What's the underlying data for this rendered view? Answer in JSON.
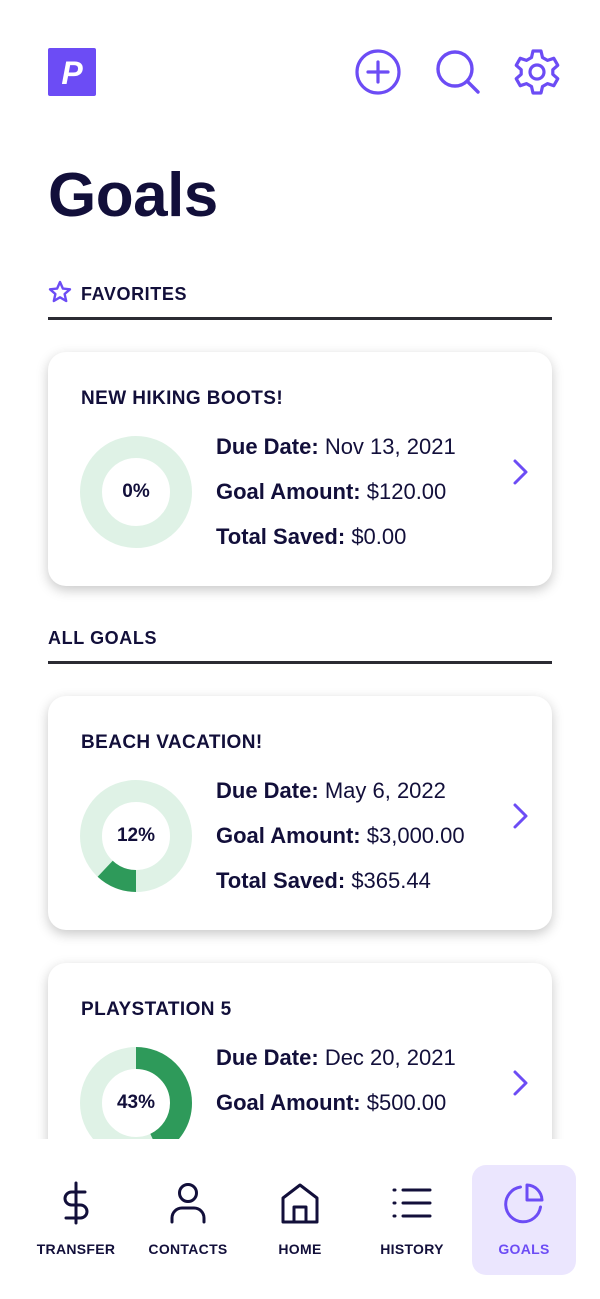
{
  "header": {
    "logo_letter": "P",
    "icons": [
      "add-circle-icon",
      "search-icon",
      "gear-icon"
    ]
  },
  "title": "Goals",
  "favorites": {
    "label": "FAVORITES",
    "goals": [
      {
        "name": "NEW HIKING BOOTS!",
        "percent_label": "0%",
        "progress": 0,
        "due_label": "Due Date:",
        "due_value": "Nov 13, 2021",
        "amount_label": "Goal Amount:",
        "amount_value": "$120.00",
        "saved_label": "Total Saved:",
        "saved_value": "$0.00"
      }
    ]
  },
  "all_goals": {
    "label": "ALL GOALS",
    "goals": [
      {
        "name": "BEACH VACATION!",
        "percent_label": "12%",
        "progress": 0.12,
        "due_label": "Due Date:",
        "due_value": "May 6, 2022",
        "amount_label": "Goal Amount:",
        "amount_value": "$3,000.00",
        "saved_label": "Total Saved:",
        "saved_value": "$365.44"
      },
      {
        "name": "PLAYSTATION 5",
        "percent_label": "43%",
        "progress": 0.43,
        "due_label": "Due Date:",
        "due_value": "Dec 20, 2021",
        "amount_label": "Goal Amount:",
        "amount_value": "$500.00"
      }
    ]
  },
  "nav": {
    "items": [
      {
        "label": "TRANSFER",
        "icon": "dollar-icon"
      },
      {
        "label": "CONTACTS",
        "icon": "person-icon"
      },
      {
        "label": "HOME",
        "icon": "home-icon"
      },
      {
        "label": "HISTORY",
        "icon": "list-icon"
      },
      {
        "label": "GOALS",
        "icon": "pie-chart-icon",
        "active": true
      }
    ]
  },
  "colors": {
    "accent": "#6c4cf5",
    "text": "#120f3a",
    "ring_track": "#dff2e6",
    "ring_fill": "#2e9a5a",
    "active_nav_bg": "#ebe6fe"
  }
}
